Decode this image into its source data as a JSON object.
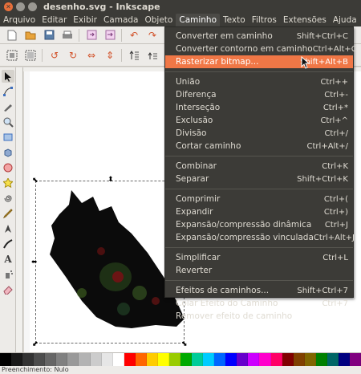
{
  "window": {
    "title": "desenho.svg - Inkscape",
    "close_glyph": "✕",
    "min_glyph": "",
    "max_glyph": ""
  },
  "menubar": {
    "items": [
      "Arquivo",
      "Editar",
      "Exibir",
      "Camada",
      "Objeto",
      "Caminho",
      "Texto",
      "Filtros",
      "Extensões",
      "Ajuda"
    ],
    "active": "Caminho"
  },
  "caminho_menu": {
    "items": [
      {
        "label": "Converter em caminho",
        "shortcut": "Shift+Ctrl+C"
      },
      {
        "label": "Converter contorno em caminho",
        "shortcut": "Ctrl+Alt+C"
      },
      {
        "label": "Rasterizar bitmap...",
        "shortcut": "Shift+Alt+B"
      },
      {
        "label": "União",
        "shortcut": "Ctrl++"
      },
      {
        "label": "Diferença",
        "shortcut": "Ctrl+-"
      },
      {
        "label": "Interseção",
        "shortcut": "Ctrl+*"
      },
      {
        "label": "Exclusão",
        "shortcut": "Ctrl+^"
      },
      {
        "label": "Divisão",
        "shortcut": "Ctrl+/"
      },
      {
        "label": "Cortar caminho",
        "shortcut": "Ctrl+Alt+/"
      },
      {
        "label": "Combinar",
        "shortcut": "Ctrl+K"
      },
      {
        "label": "Separar",
        "shortcut": "Shift+Ctrl+K"
      },
      {
        "label": "Comprimir",
        "shortcut": "Ctrl+("
      },
      {
        "label": "Expandir",
        "shortcut": "Ctrl+)"
      },
      {
        "label": "Expansão/compressão dinâmica",
        "shortcut": "Ctrl+J"
      },
      {
        "label": "Expansão/compressão vinculada",
        "shortcut": "Ctrl+Alt+J"
      },
      {
        "label": "Simplificar",
        "shortcut": "Ctrl+L"
      },
      {
        "label": "Reverter",
        "shortcut": ""
      },
      {
        "label": "Efeitos de caminhos...",
        "shortcut": "Shift+Ctrl+7"
      },
      {
        "label": "Colar Efeito do Caminho",
        "shortcut": "Ctrl+7"
      },
      {
        "label": "Remover efeito de caminho",
        "shortcut": ""
      }
    ],
    "highlighted_index": 2,
    "highlight_color": "#f07746"
  },
  "toolbar1_icons": [
    "new-icon",
    "open-icon",
    "save-icon",
    "print-icon",
    "import-icon",
    "export-icon",
    "undo-icon",
    "redo-icon"
  ],
  "toolbar2_icons": [
    "select-all-icon",
    "select-all-layers-icon",
    "rotate-ccw-icon",
    "rotate-cw-icon",
    "flip-horizontal-icon",
    "flip-vertical-icon",
    "raise-to-top-icon",
    "raise-icon"
  ],
  "tools": [
    "selector-tool-icon",
    "node-tool-icon",
    "tweak-tool-icon",
    "zoom-tool-icon",
    "rectangle-tool-icon",
    "3d-box-tool-icon",
    "ellipse-tool-icon",
    "star-tool-icon",
    "spiral-tool-icon",
    "pencil-tool-icon",
    "pen-tool-icon",
    "calligraphy-tool-icon",
    "text-tool-icon",
    "spray-tool-icon",
    "eraser-tool-icon"
  ],
  "palette": [
    "#000000",
    "#1a1a1a",
    "#333333",
    "#4d4d4d",
    "#666666",
    "#808080",
    "#999999",
    "#b3b3b3",
    "#cccccc",
    "#e6e6e6",
    "#ffffff",
    "#ff0000",
    "#ff6600",
    "#ffcc00",
    "#ffff00",
    "#99cc00",
    "#00aa00",
    "#00cc99",
    "#00ccff",
    "#0066ff",
    "#0000ff",
    "#6600cc",
    "#cc00ff",
    "#ff00cc",
    "#ff0066",
    "#800000",
    "#804000",
    "#806600",
    "#008000",
    "#006666",
    "#000080",
    "#800080"
  ],
  "status": {
    "text": "Preenchimento: Nulo"
  }
}
